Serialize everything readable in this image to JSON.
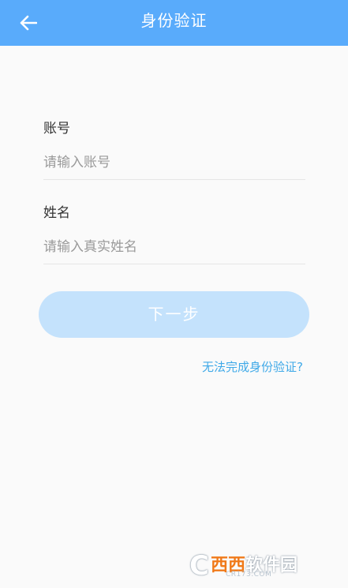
{
  "header": {
    "title": "身份验证",
    "back_icon": "arrow-left-icon",
    "background_color": "#59abfb"
  },
  "form": {
    "account": {
      "label": "账号",
      "placeholder": "请输入账号",
      "value": ""
    },
    "name": {
      "label": "姓名",
      "placeholder": "请输入真实姓名",
      "value": ""
    }
  },
  "actions": {
    "next_label": "下一步",
    "next_button_color": "#c4e2fc",
    "help_link": "无法完成身份验证?",
    "help_link_color": "#3fa9e8"
  },
  "watermark": {
    "brand_letter": "C",
    "brand_a": "西西",
    "brand_b": "软件园",
    "site": "CR173.COM"
  }
}
